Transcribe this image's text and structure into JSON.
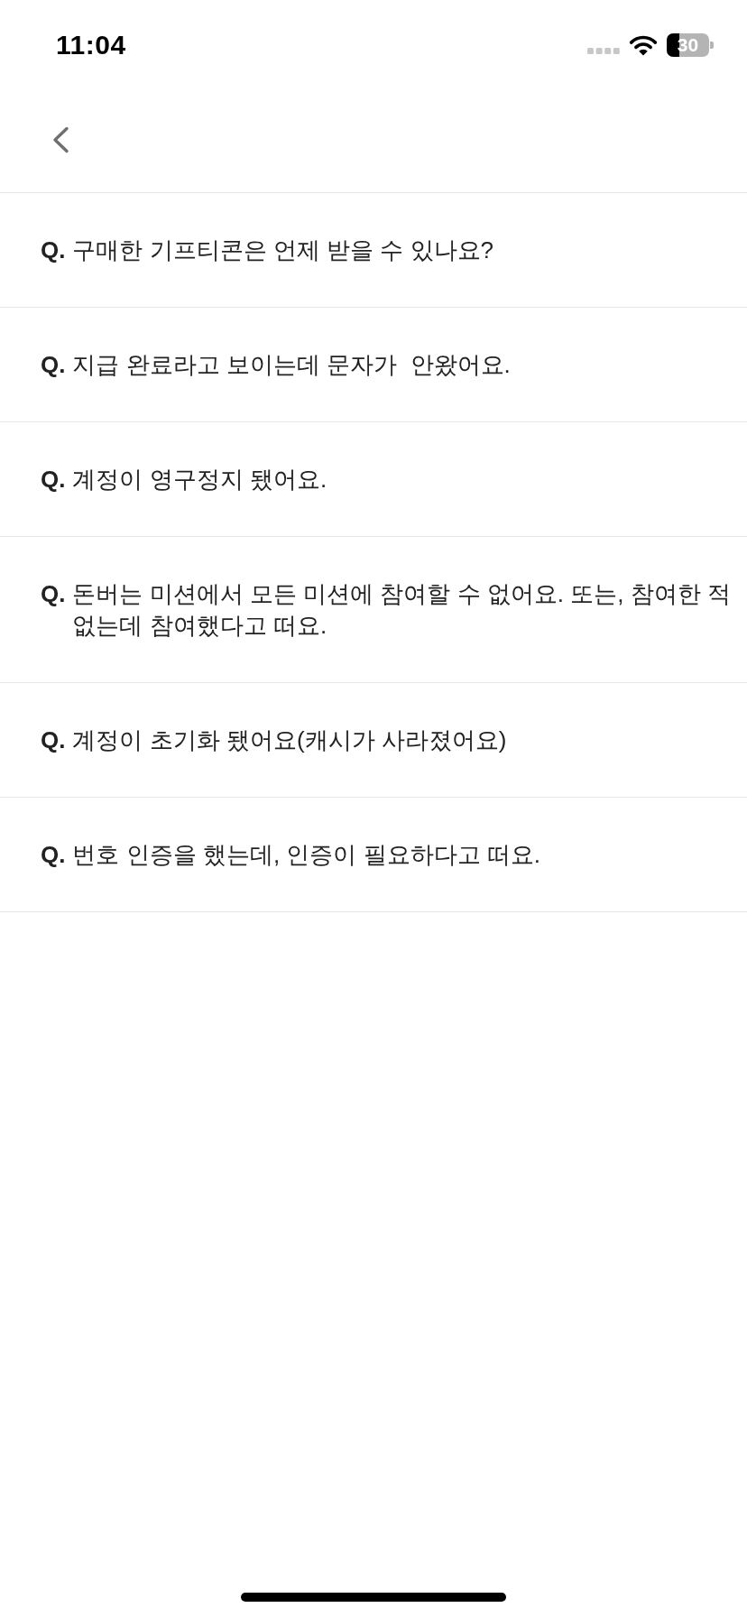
{
  "status_bar": {
    "time": "11:04",
    "battery": "30"
  },
  "faq": [
    {
      "prefix": "Q.",
      "question": "구매한 기프티콘은 언제 받을 수 있나요?"
    },
    {
      "prefix": "Q.",
      "question": "지급 완료라고 보이는데 문자가  안왔어요."
    },
    {
      "prefix": "Q.",
      "question": "계정이 영구정지 됐어요."
    },
    {
      "prefix": "Q.",
      "question": "돈버는 미션에서 모든 미션에 참여할 수 없어요. 또는, 참여한 적 없는데 참여했다고 떠요."
    },
    {
      "prefix": "Q.",
      "question": "계정이 초기화 됐어요(캐시가 사라졌어요)"
    },
    {
      "prefix": "Q.",
      "question": "번호 인증을 했는데, 인증이 필요하다고 떠요."
    }
  ]
}
